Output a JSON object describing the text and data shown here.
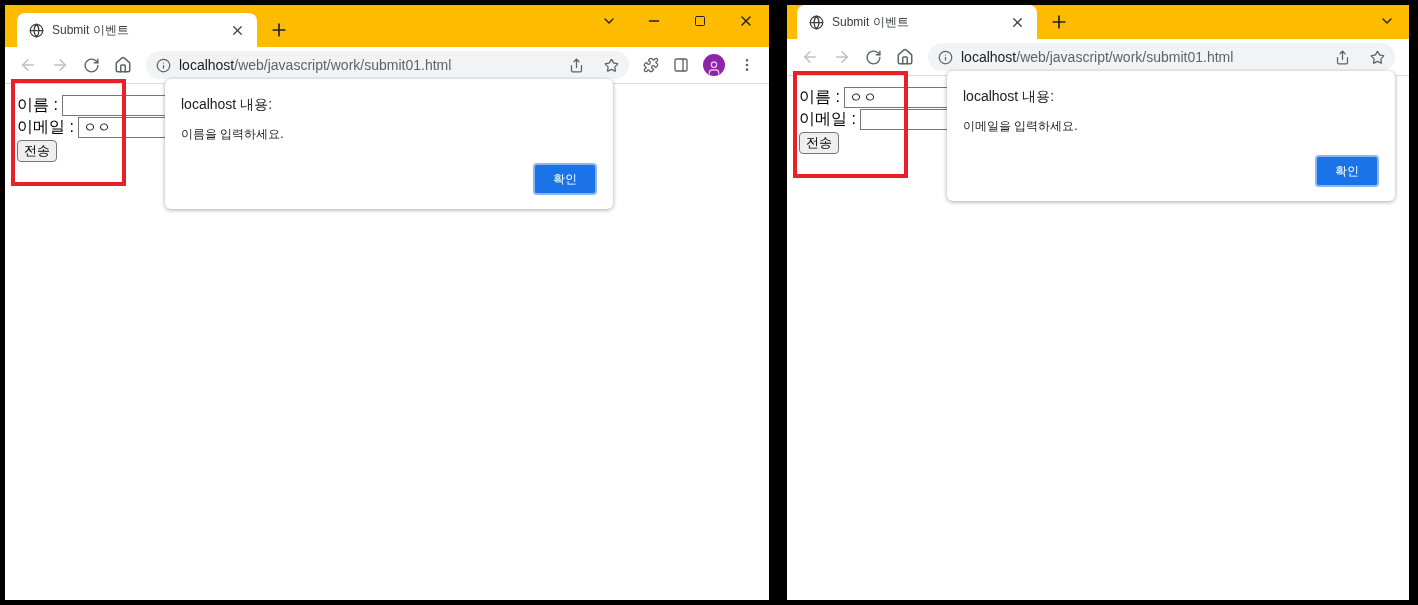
{
  "windows": [
    {
      "tab": {
        "title": "Submit 이벤트",
        "selected": true
      },
      "window_controls": true,
      "profile_toolbar": true,
      "url": {
        "host": "localhost",
        "path": "/web/javascript/work/submit01.html"
      },
      "form": {
        "name_label": "이름 :",
        "email_label": "이메일 :",
        "email_value": "ㅇㅇ",
        "submit": "전송"
      },
      "highlight": true,
      "dialog": {
        "title": "localhost 내용:",
        "message": "이름을 입력하세요.",
        "button": "확인"
      }
    },
    {
      "tab": {
        "title": "Submit 이벤트",
        "selected": true
      },
      "window_controls": false,
      "profile_toolbar": false,
      "url": {
        "host": "localhost",
        "path": "/web/javascript/work/submit01.html"
      },
      "form": {
        "name_label": "이름 :",
        "name_value": "ㅇㅇ",
        "email_label": "이메일 :",
        "submit": "전송"
      },
      "highlight": true,
      "dialog": {
        "title": "localhost 내용:",
        "message": "이메일을 입력하세요.",
        "button": "확인"
      }
    }
  ]
}
